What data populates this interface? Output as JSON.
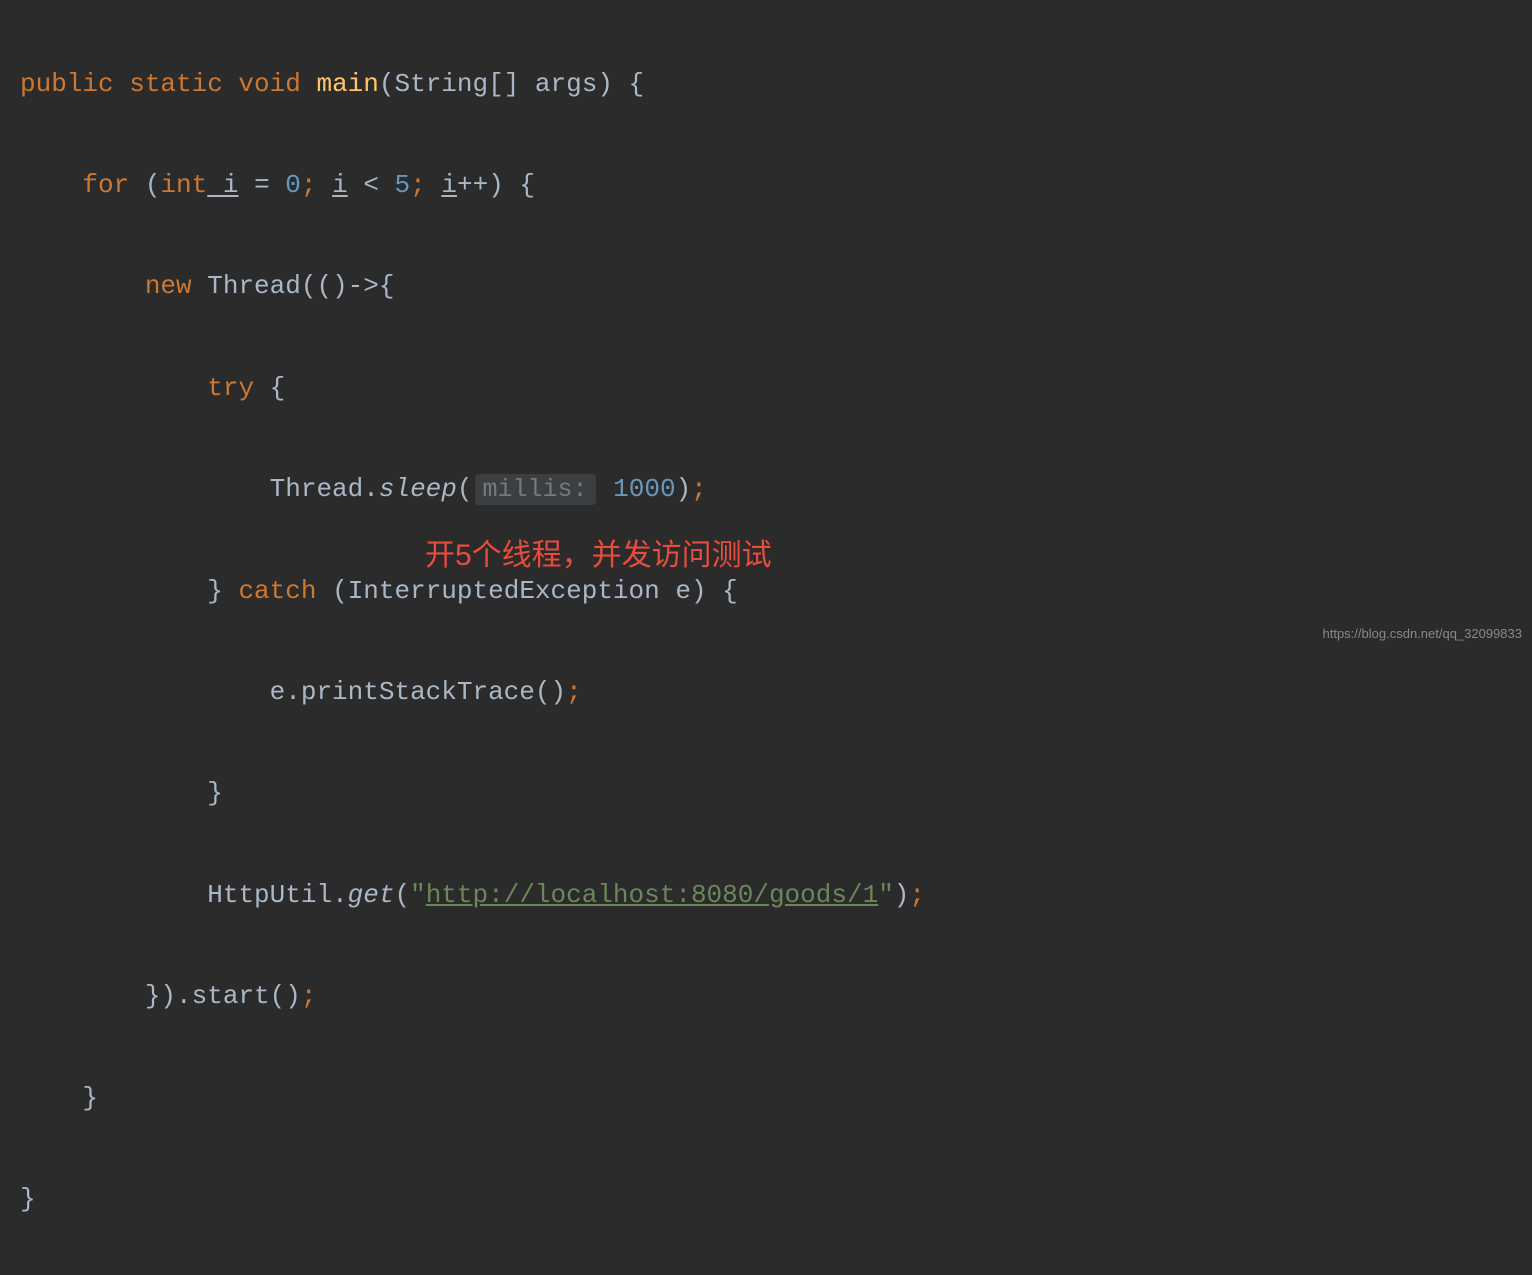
{
  "code": {
    "line1": {
      "modifiers": "public static void",
      "method_name": "main",
      "param_type": "String[] args",
      "brace_open": " {"
    },
    "line2": {
      "kw_for": "for",
      "paren_open": " (",
      "kw_int": "int",
      "var_i": " i",
      "eq": " = ",
      "num_0": "0",
      "semi1": "; ",
      "var_i2": "i",
      "lt": " < ",
      "num_5": "5",
      "semi2": "; ",
      "var_i3": "i",
      "inc": "++",
      "paren_close": ") {"
    },
    "line3": {
      "kw_new": "new",
      "thread": " Thread(()->{",
      "thread_class": "Thread"
    },
    "line4": {
      "kw_try": "try",
      "brace": " {"
    },
    "line5": {
      "thread_class": "Thread",
      "dot": ".",
      "sleep": "sleep",
      "paren_open": "(",
      "hint": "millis:",
      "num": "1000",
      "close": ")",
      "semi": ";"
    },
    "line6": {
      "brace_close": "} ",
      "kw_catch": "catch",
      "paren_open": " (",
      "exc_type": "InterruptedException e",
      "paren_close": ") {"
    },
    "line7": {
      "call": "e.printStackTrace()",
      "semi": ";"
    },
    "line8": {
      "brace": "}"
    },
    "line9": {
      "class": "HttpUtil",
      "dot": ".",
      "method": "get",
      "paren_open": "(",
      "quote": "\"",
      "url": "http://localhost:8080/goods/1",
      "quote_close": "\"",
      "paren_close": ")",
      "semi": ";"
    },
    "line10": {
      "close": "}).start()",
      "semi": ";"
    },
    "line11": {
      "brace": "}"
    },
    "line12": {
      "brace": "}"
    }
  },
  "annotation": "开5个线程，并发访问测试",
  "watermark": "https://blog.csdn.net/qq_32099833"
}
